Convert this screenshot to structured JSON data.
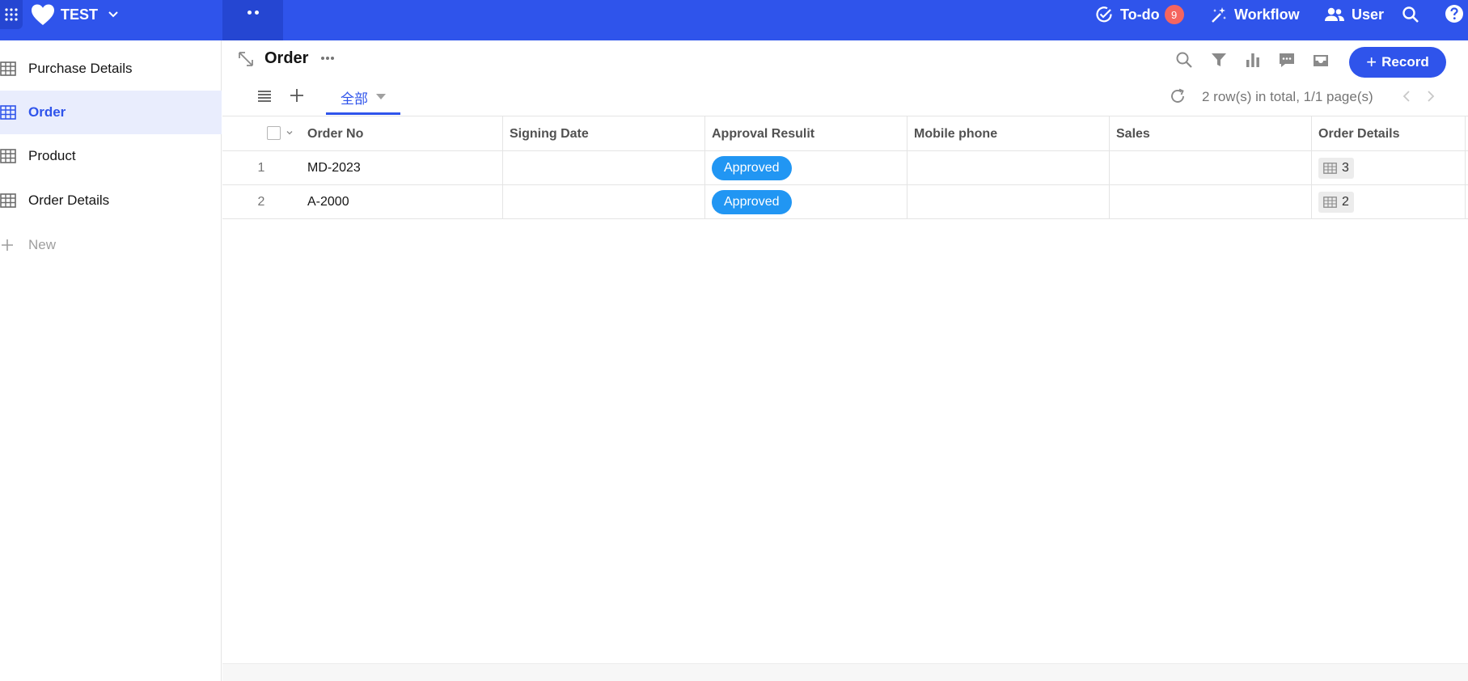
{
  "app": {
    "name": "TEST"
  },
  "colors": {
    "brand": "#2f54eb",
    "approved": "#2196f3",
    "badge": "#f5655f"
  },
  "topbar": {
    "todo_label": "To-do",
    "todo_count": "9",
    "workflow_label": "Workflow",
    "user_label": "User"
  },
  "sidebar": {
    "items": [
      {
        "label": "Purchase Details",
        "icon": "table-icon"
      },
      {
        "label": "Order",
        "icon": "table-icon",
        "active": true
      },
      {
        "label": "Product",
        "icon": "table-icon"
      },
      {
        "label": "Order Details",
        "icon": "table-icon"
      }
    ],
    "new_label": "New"
  },
  "header": {
    "title": "Order",
    "record_label": "Record"
  },
  "views": {
    "active_view": "全部",
    "row_info": "2 row(s) in total, 1/1 page(s)"
  },
  "table": {
    "columns": [
      "Order No",
      "Signing Date",
      "Approval Resulit",
      "Mobile phone",
      "Sales",
      "Order Details"
    ],
    "rows": [
      {
        "index": "1",
        "order_no": "MD-2023",
        "signing_date": "",
        "approval": "Approved",
        "mobile": "",
        "sales": "",
        "details_count": "3"
      },
      {
        "index": "2",
        "order_no": "A-2000",
        "signing_date": "",
        "approval": "Approved",
        "mobile": "",
        "sales": "",
        "details_count": "2"
      }
    ]
  }
}
